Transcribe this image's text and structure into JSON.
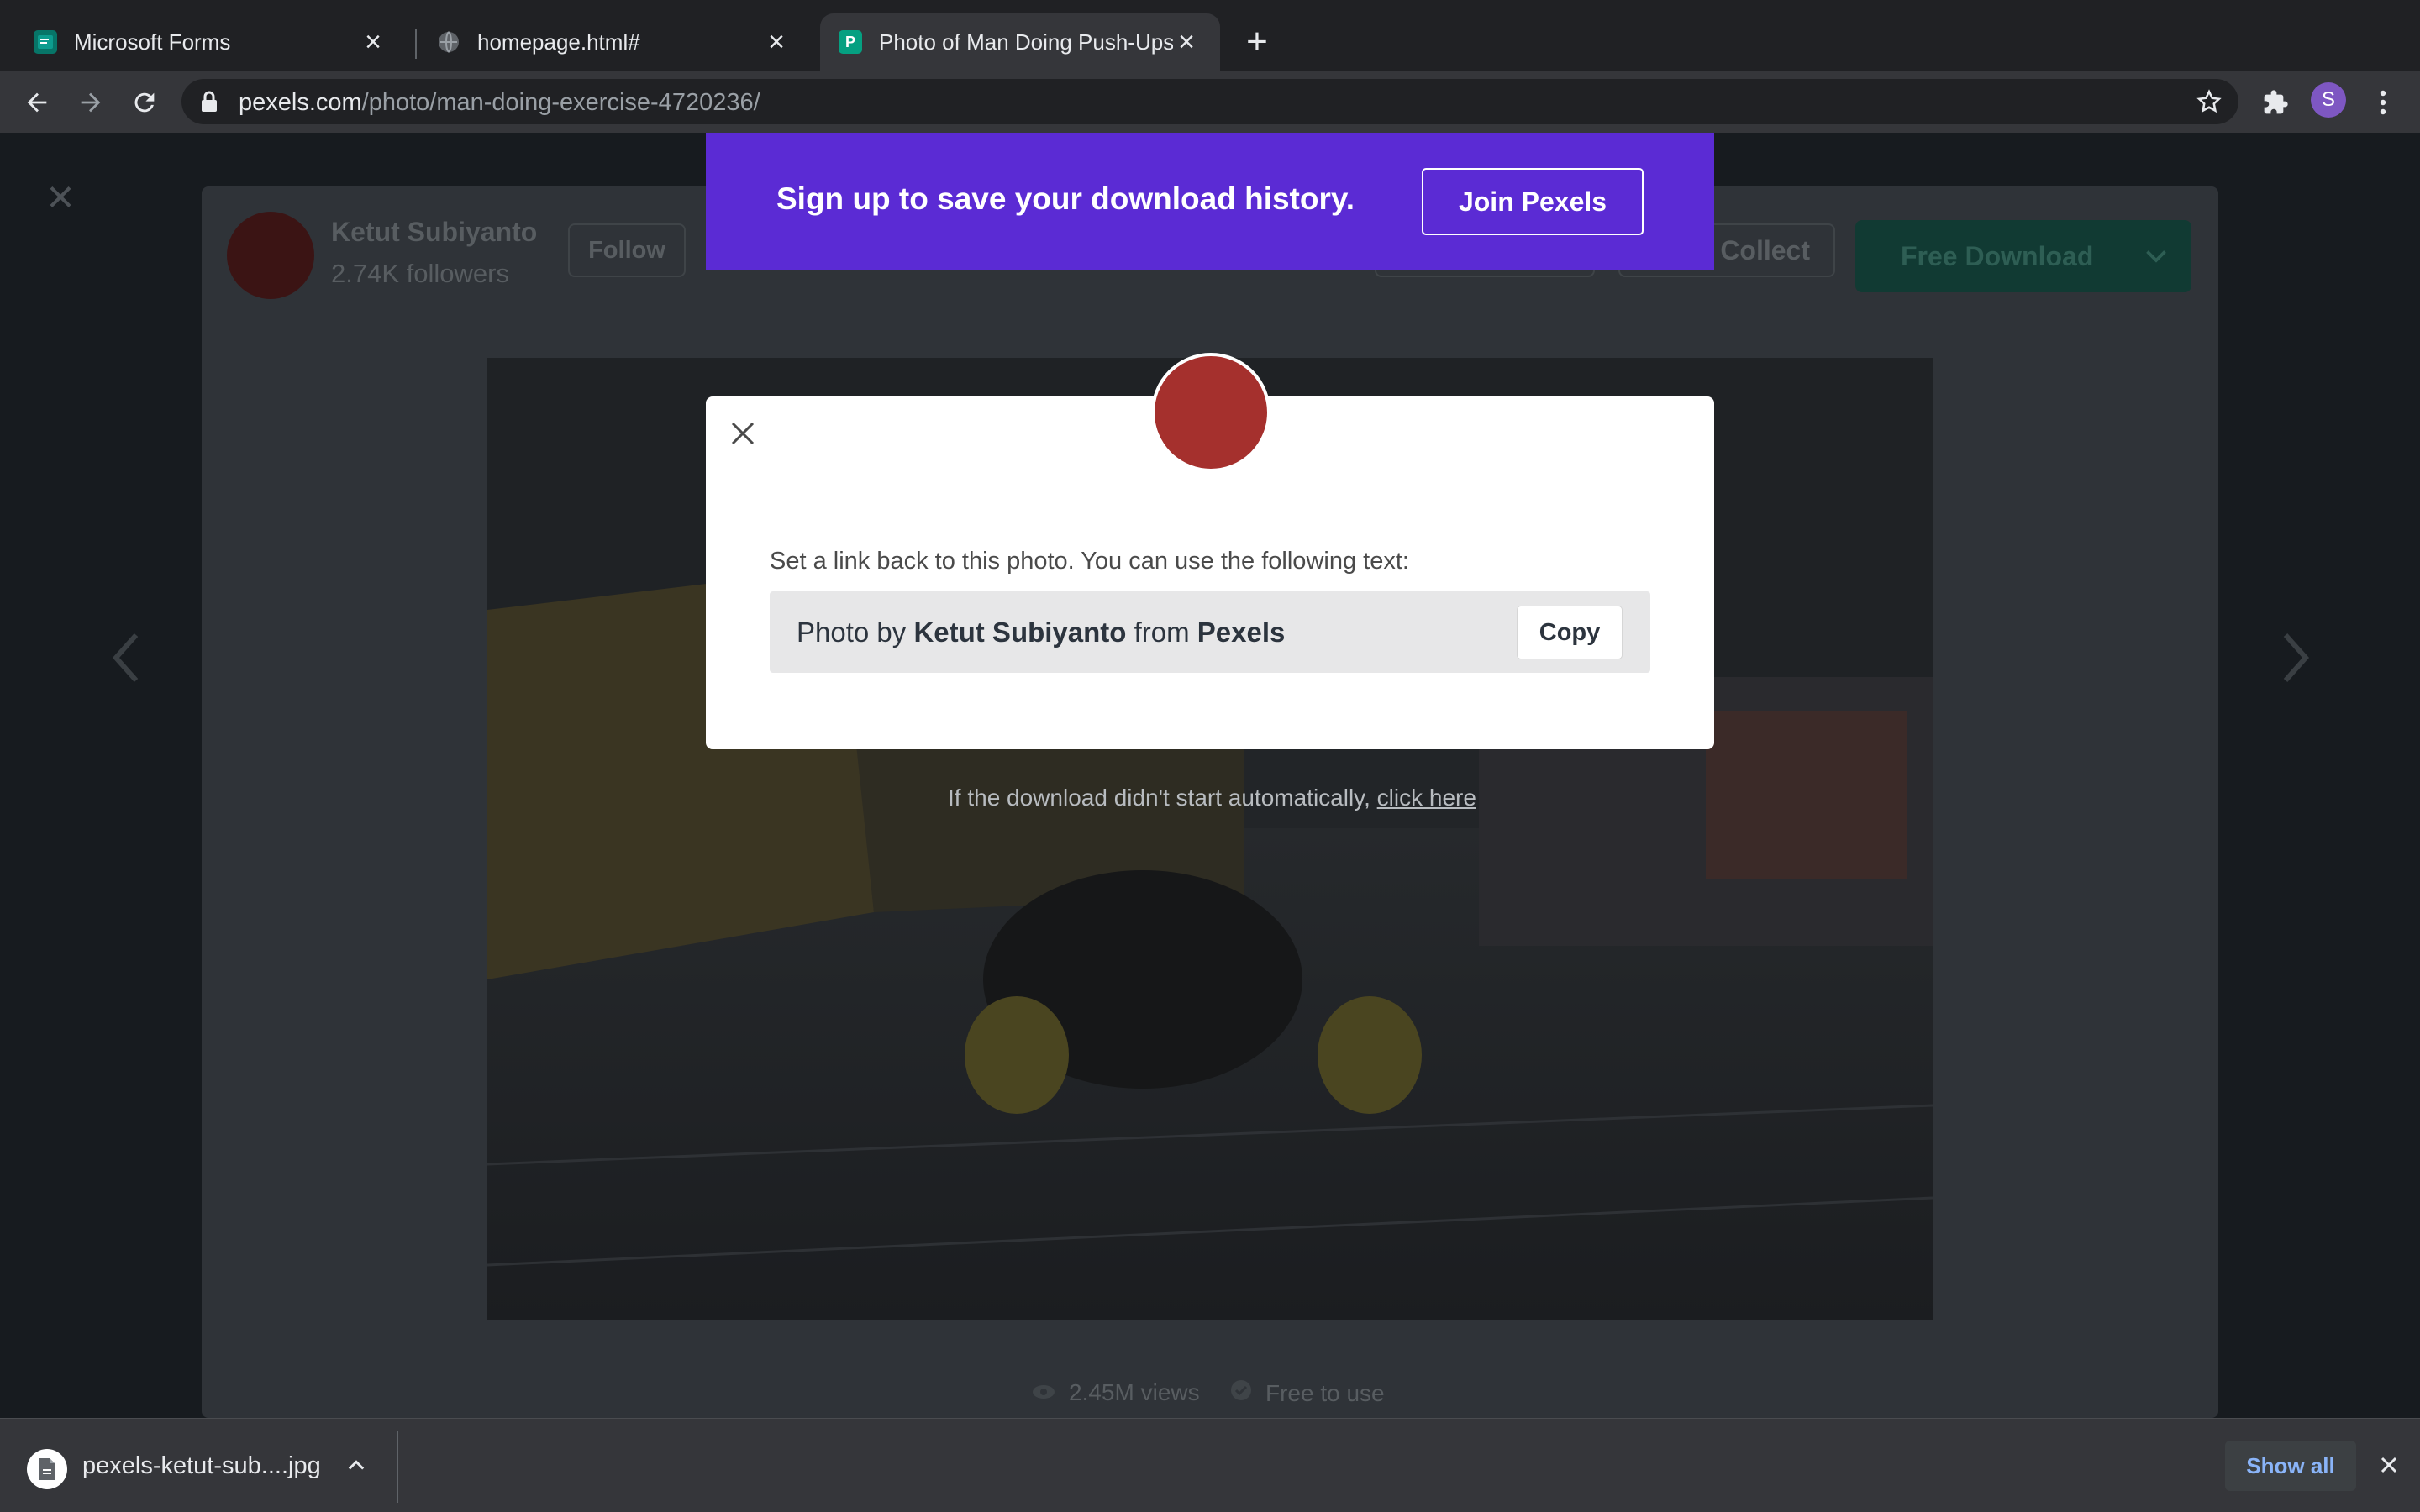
{
  "browser": {
    "tabs": [
      {
        "title": "Microsoft Forms",
        "favicon": "microsoft-forms-icon",
        "active": false
      },
      {
        "title": "homepage.html#",
        "favicon": "globe-icon",
        "active": false
      },
      {
        "title": "Photo of Man Doing Push-Ups",
        "favicon": "pexels-icon",
        "active": true
      }
    ],
    "url_host": "pexels.com",
    "url_path": "/photo/man-doing-exercise-4720236/",
    "profile_initial": "S"
  },
  "background_page": {
    "author_name": "Ketut Subiyanto",
    "author_followers": "2.74K followers",
    "follow_label": "Follow",
    "collect_label": "Collect",
    "download_label": "Free Download",
    "views": "2.45M views",
    "license": "Free to use"
  },
  "promo": {
    "text": "Sign up to save your download history.",
    "button": "Join Pexels"
  },
  "modal": {
    "instruction": "Set a link back to this photo. You can use the following text:",
    "credit_prefix": "Photo by",
    "credit_author": "Ketut Subiyanto",
    "credit_mid": "from",
    "credit_site": "Pexels",
    "copy_label": "Copy"
  },
  "download_note": {
    "text": "If the download didn't start automatically,",
    "link": "click here"
  },
  "downloads": {
    "filename": "pexels-ketut-sub....jpg",
    "show_all": "Show all"
  },
  "colors": {
    "promo_bg": "#5b2bd4",
    "modal_avatar": "#a5302d",
    "chrome_bg": "#202124",
    "download_button": "#113a33"
  }
}
